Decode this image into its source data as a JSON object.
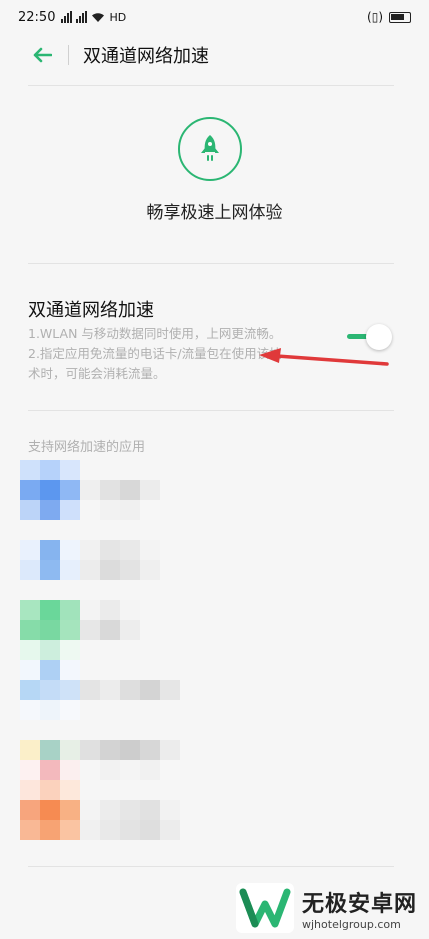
{
  "status_bar": {
    "time": "22:50",
    "network": "HD",
    "icons": [
      "signal-icon",
      "signal-icon",
      "wifi-icon",
      "vibrate-icon",
      "battery-icon"
    ]
  },
  "header": {
    "title": "双通道网络加速"
  },
  "hero": {
    "icon": "rocket-icon",
    "text": "畅享极速上网体验"
  },
  "feature": {
    "title": "双通道网络加速",
    "desc_line1": "1.WLAN 与移动数据同时使用，上网更流畅。",
    "desc_line2": "2.指定应用免流量的电话卡/流量包在使用该技",
    "desc_line3": "术时，可能会消耗流量。",
    "toggle_on": true
  },
  "apps": {
    "section_label": "支持网络加速的应用"
  },
  "colors": {
    "accent": "#2bb673",
    "arrow": "#e0393a"
  },
  "watermark": {
    "title": "无极安卓网",
    "url": "wjhotelgroup.com"
  }
}
